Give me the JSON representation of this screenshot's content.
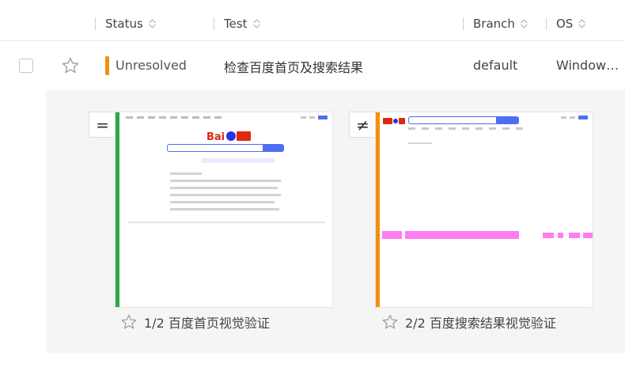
{
  "header": {
    "status_label": "Status",
    "test_label": "Test",
    "branch_label": "Branch",
    "os_label": "OS"
  },
  "row": {
    "status": "Unresolved",
    "status_color": "#f2910a",
    "test_name": "检查百度首页及搜索结果",
    "branch": "default",
    "os": "Window…"
  },
  "checkpoints": [
    {
      "compare_symbol": "=",
      "caption": "1/2 百度首页视觉验证",
      "bar_color": "#2aa84a"
    },
    {
      "compare_symbol": "≠",
      "caption": "2/2 百度搜索结果视觉验证",
      "bar_color": "#f2910a"
    }
  ],
  "colors": {
    "accent_blue": "#4e6ef2",
    "diff_pink": "#ff7cf2"
  }
}
